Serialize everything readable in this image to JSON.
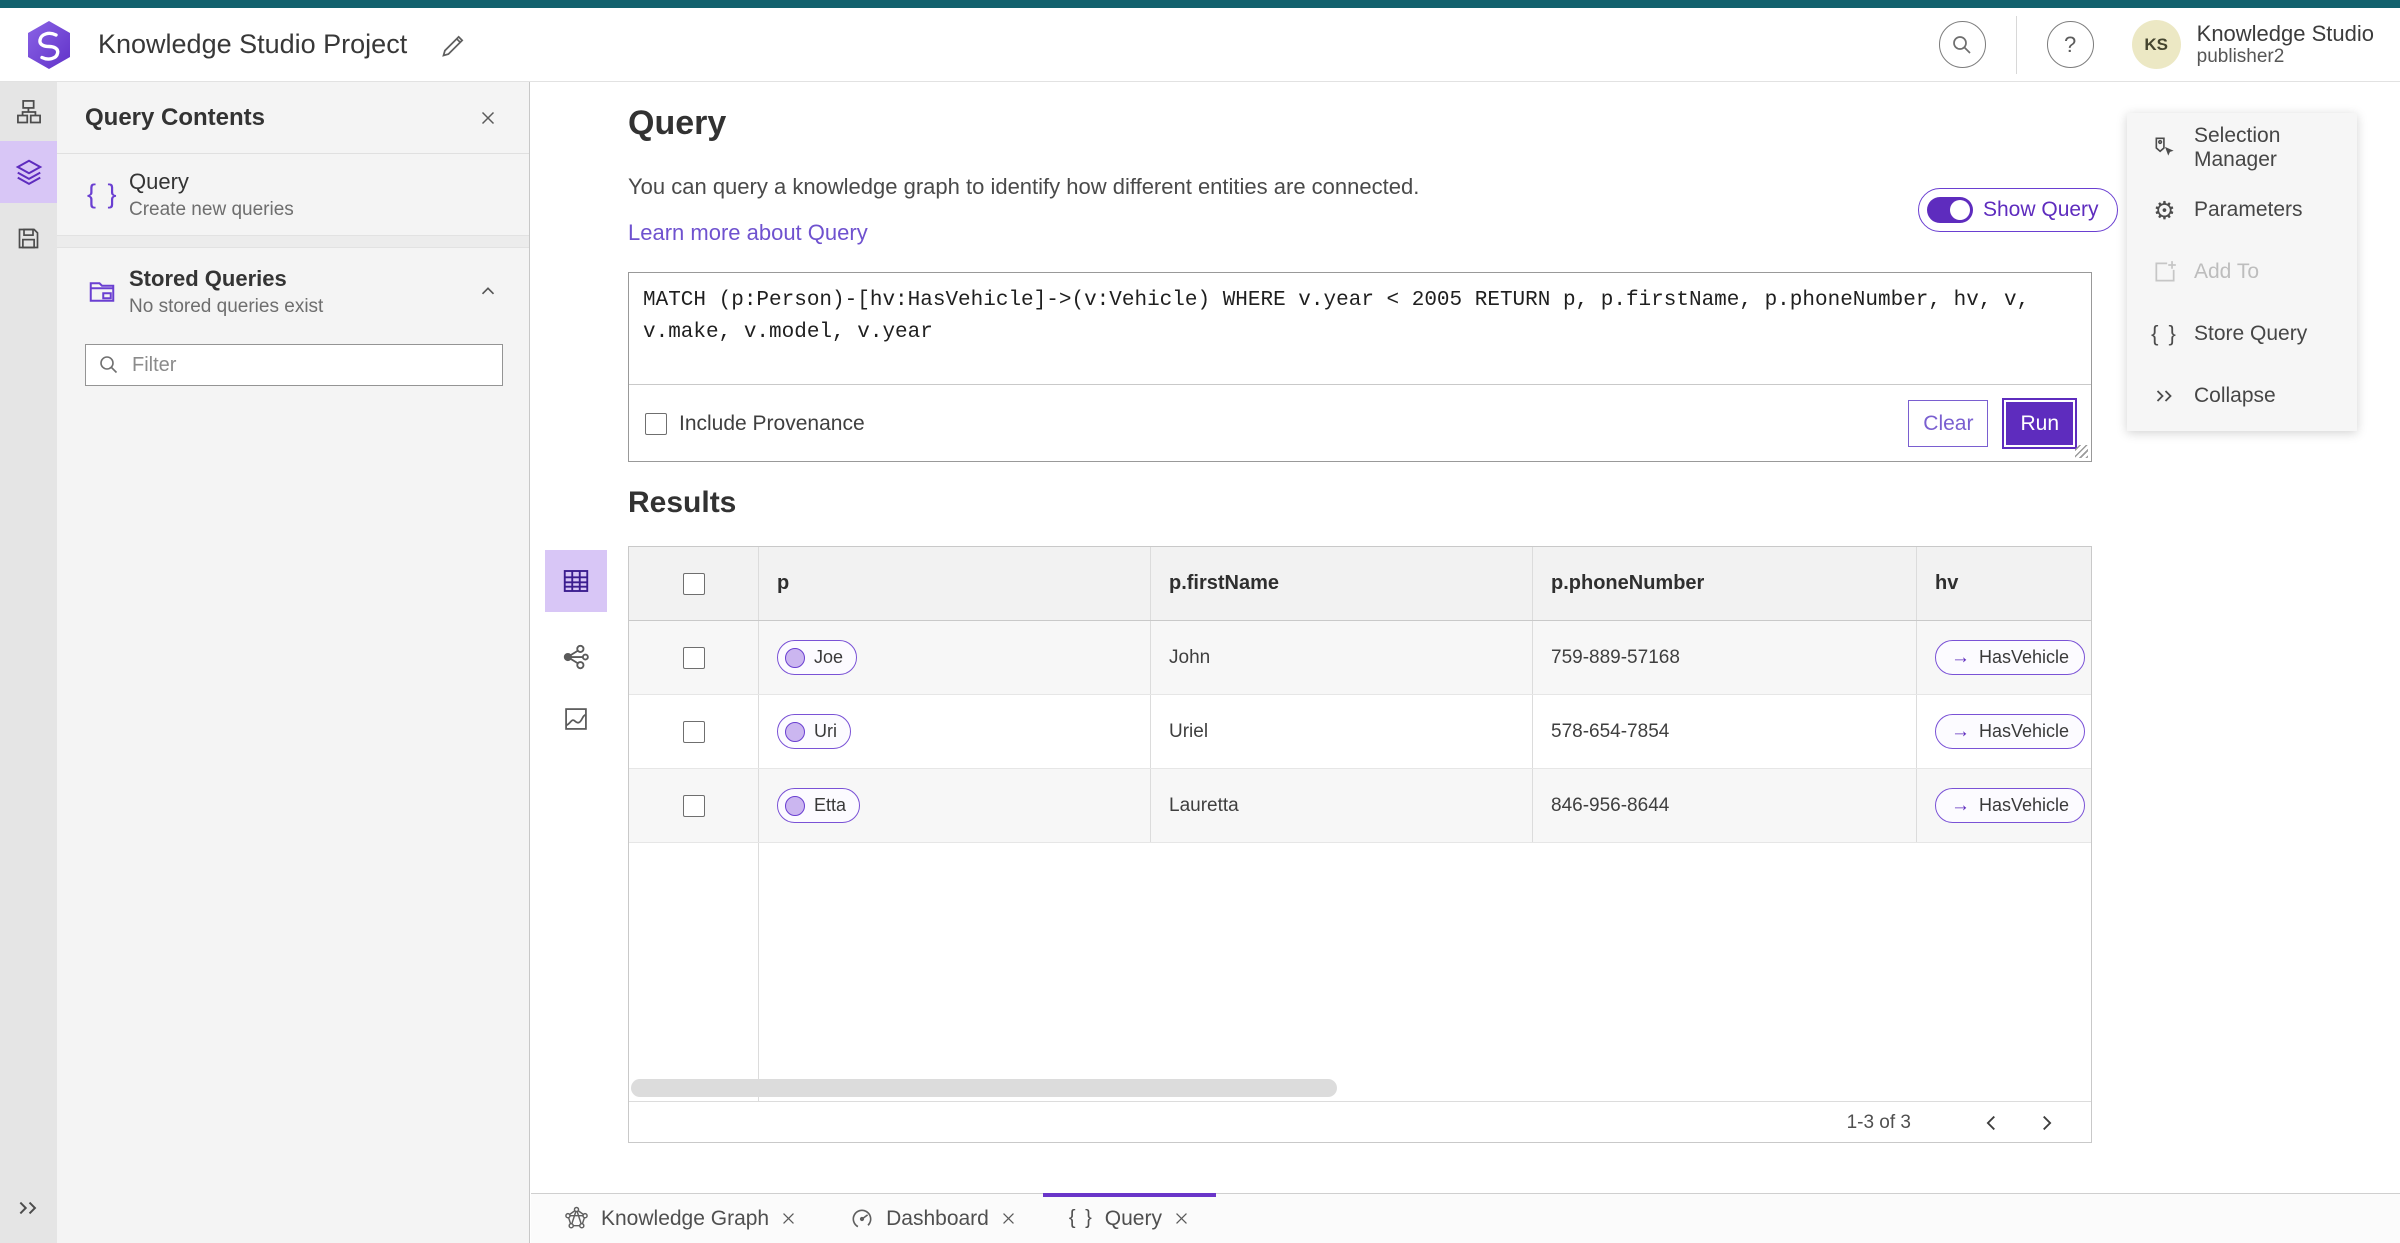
{
  "colors": {
    "teal_top_bar": "#12616d",
    "accent_purple": "#5e2cbe",
    "light_purple_selection": "#d8c6f6",
    "pill_border_purple": "#7a52d6",
    "link_purple": "#6f52cf",
    "avatar_bg": "#ece8c4"
  },
  "icons": {
    "braces": "{ }",
    "arrow_right": "→",
    "question_mark": "?",
    "gear": "⚙"
  },
  "header": {
    "app_title": "Knowledge Studio Project",
    "user_org": "Knowledge Studio",
    "user_name": "publisher2",
    "user_initials": "KS"
  },
  "left_panel": {
    "title": "Query Contents",
    "query_item": {
      "label": "Query",
      "sublabel": "Create new queries"
    },
    "stored_item": {
      "label": "Stored Queries",
      "sublabel": "No stored queries exist"
    },
    "filter_placeholder": "Filter"
  },
  "query_section": {
    "title": "Query",
    "description": "You can query a knowledge graph to identify how different entities are connected.",
    "learn_more_label": "Learn more about Query",
    "show_query_label": "Show Query",
    "query_text": "MATCH (p:Person)-[hv:HasVehicle]->(v:Vehicle) WHERE v.year < 2005 RETURN p, p.firstName, p.phoneNumber, hv, v, v.make, v.model, v.year",
    "include_provenance_label": "Include Provenance",
    "clear_label": "Clear",
    "run_label": "Run"
  },
  "results": {
    "title": "Results",
    "columns": [
      "p",
      "p.firstName",
      "p.phoneNumber",
      "hv"
    ],
    "rows": [
      {
        "p": "Joe",
        "firstName": "John",
        "phoneNumber": "759-889-57168",
        "hv": "HasVehicle"
      },
      {
        "p": "Uri",
        "firstName": "Uriel",
        "phoneNumber": "578-654-7854",
        "hv": "HasVehicle"
      },
      {
        "p": "Etta",
        "firstName": "Lauretta",
        "phoneNumber": "846-956-8644",
        "hv": "HasVehicle"
      }
    ],
    "pagination": "1-3 of 3"
  },
  "right_panel": {
    "items": [
      {
        "label": "Selection Manager",
        "icon": "selection-manager",
        "disabled": false
      },
      {
        "label": "Parameters",
        "icon": "gear",
        "disabled": false
      },
      {
        "label": "Add To",
        "icon": "add-to",
        "disabled": true
      },
      {
        "label": "Store Query",
        "icon": "braces",
        "disabled": false
      },
      {
        "label": "Collapse",
        "icon": "double-chevron",
        "disabled": false
      }
    ]
  },
  "tabs": [
    {
      "label": "Knowledge Graph",
      "icon": "knowledge-graph",
      "active": false
    },
    {
      "label": "Dashboard",
      "icon": "dashboard",
      "active": false
    },
    {
      "label": "Query",
      "icon": "braces",
      "active": true
    }
  ]
}
